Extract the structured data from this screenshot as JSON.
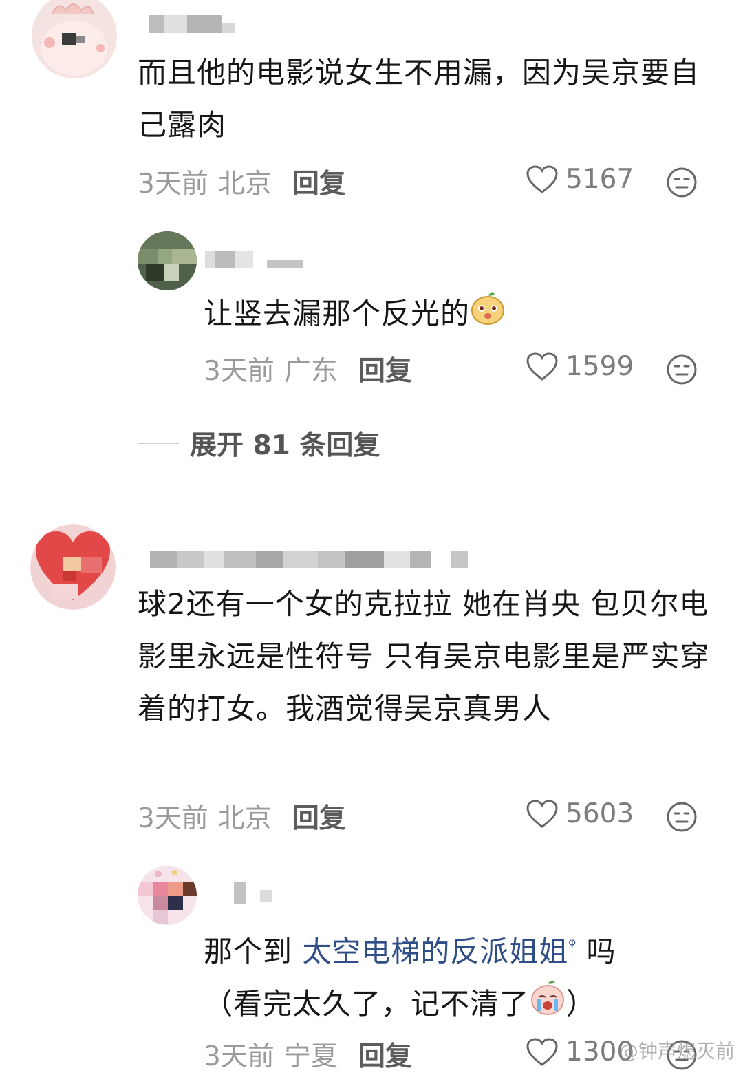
{
  "comments": [
    {
      "text": "而且他的电影说女生不用漏，因为吴京要自己露肉",
      "time": "3天前",
      "location": "北京",
      "reply_label": "回复",
      "likes": "5167",
      "avatar_icon": "pink-dino-avatar",
      "replies": [
        {
          "text": "让竖去漏那个反光的",
          "emoji_icon": "yellow-bear-emoji",
          "time": "3天前",
          "location": "广东",
          "reply_label": "回复",
          "likes": "1599",
          "avatar_icon": "plant-avatar"
        }
      ],
      "expand_label": "展开 81 条回复"
    },
    {
      "text": "球2还有一个女的克拉拉 她在肖央 包贝尔电影里永远是性符号 只有吴京电影里是严实穿着的打女。我酒觉得吴京真男人",
      "time": "3天前",
      "location": "北京",
      "reply_label": "回复",
      "likes": "5603",
      "avatar_icon": "red-heart-avatar",
      "replies": [
        {
          "text_before": "那个到 ",
          "link_text": "太空电梯的反派姐姐",
          "link_suffix": "ᵠ",
          "text_after_line1": " 吗",
          "text_line2": "（看完太久了，记不清了",
          "text_line2_end": "）",
          "emoji_icon": "crying-face-emoji",
          "time": "3天前",
          "location": "宁夏",
          "reply_label": "回复",
          "likes": "1300",
          "avatar_icon": "pastel-avatar"
        }
      ]
    }
  ],
  "watermark": "@钟声熄灭前",
  "colors": {
    "link": "#2f4d86",
    "meta": "#9a9a9a"
  }
}
